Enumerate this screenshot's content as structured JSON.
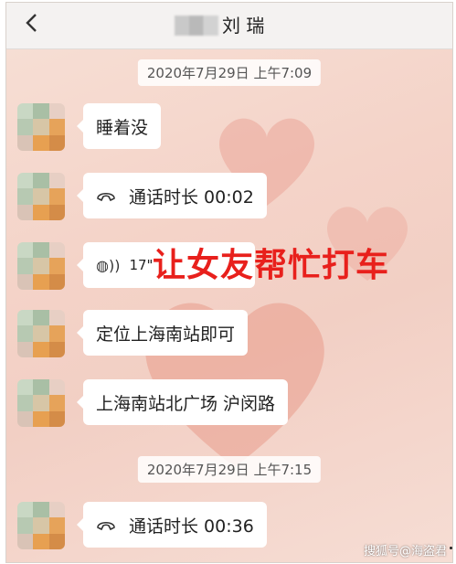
{
  "header": {
    "back_icon": "chevron-left-icon",
    "title": "刘  瑞"
  },
  "messages": [
    {
      "type": "timestamp",
      "text": "2020年7月29日 上午7:09"
    },
    {
      "type": "text",
      "text": "睡着没"
    },
    {
      "type": "call",
      "icon": "phone-icon",
      "text": "通话时长 00:02"
    },
    {
      "type": "voice",
      "icon": "voice-icon",
      "text": "17\""
    },
    {
      "type": "text",
      "text": "定位上海南站即可"
    },
    {
      "type": "text",
      "text": "上海南站北广场 沪闵路"
    },
    {
      "type": "timestamp",
      "text": "2020年7月29日 上午7:15"
    },
    {
      "type": "call",
      "icon": "phone-icon",
      "text": "通话时长 00:36"
    }
  ],
  "overlay_caption": "让女友帮忙打车",
  "watermark": "搜狐号@海盗君",
  "colors": {
    "overlay_red": "#e8201c",
    "bubble": "#ffffff",
    "background": "#f4d3c8"
  }
}
